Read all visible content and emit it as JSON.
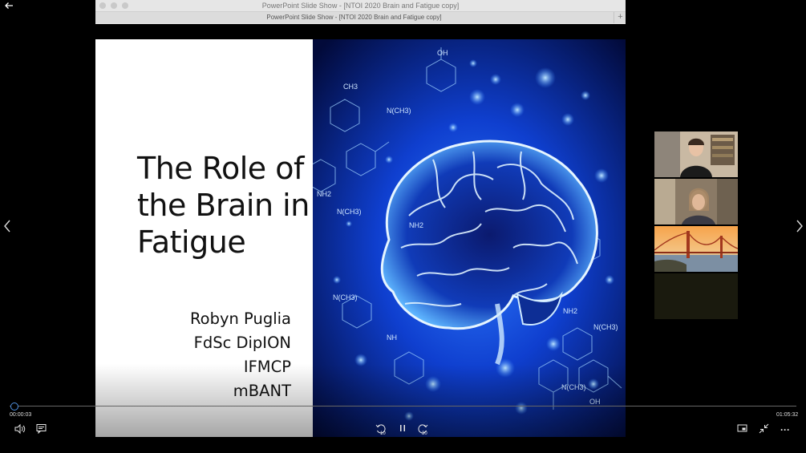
{
  "window": {
    "title": "PowerPoint Slide Show - [NTOI 2020 Brain and Fatigue copy]",
    "tab_label": "PowerPoint Slide Show - [NTOI 2020 Brain and Fatigue copy]",
    "new_tab_symbol": "+"
  },
  "slide": {
    "title_lines": [
      "The Role of",
      "the Brain in",
      "Fatigue"
    ],
    "author_lines": [
      "Robyn Puglia",
      "FdSc DipION",
      "IFMCP",
      "mBANT"
    ],
    "image_labels": [
      "OH",
      "CH3",
      "N(CH3)",
      "NH2",
      "N(CH3)",
      "NH2",
      "N(CH3)",
      "N(CH3)",
      "NH2",
      "OH",
      "NH",
      "N(CH3)"
    ]
  },
  "player": {
    "back_icon": "back-arrow-icon",
    "prev_icon": "chevron-left-icon",
    "next_icon": "chevron-right-icon",
    "elapsed": "00:00:03",
    "total": "01:05:32",
    "progress": 0.001,
    "skip_back_seconds": "10",
    "skip_forward_seconds": "30",
    "volume_icon": "volume-icon",
    "captions_icon": "captions-icon",
    "pause_icon": "pause-icon",
    "miniview_icon": "mini-view-icon",
    "exit_fullscreen_icon": "exit-fullscreen-icon",
    "more_icon": "more-options-icon",
    "more_symbol": "···"
  },
  "colors": {
    "accent": "#4d8fe0",
    "background": "#000000",
    "brain_glow": "#1e6bff"
  }
}
